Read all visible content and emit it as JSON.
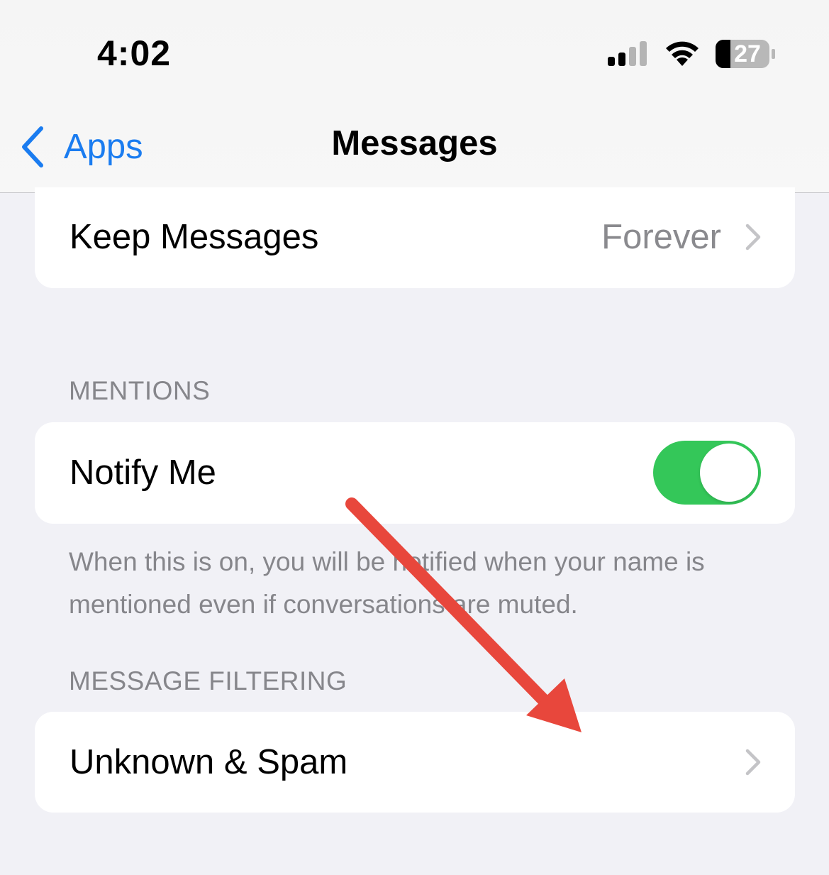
{
  "status_bar": {
    "time": "4:02",
    "battery_level": "27",
    "signal_bars_filled": 2,
    "signal_bars_total": 4
  },
  "nav": {
    "back_label": "Apps",
    "title": "Messages"
  },
  "keep_messages": {
    "label": "Keep Messages",
    "value": "Forever"
  },
  "mentions": {
    "header": "MENTIONS",
    "notify_label": "Notify Me",
    "notify_on": true,
    "footer": "When this is on, you will be notified when your name is mentioned even if conversations are muted."
  },
  "filtering": {
    "header": "MESSAGE FILTERING",
    "unknown_spam_label": "Unknown & Spam"
  },
  "colors": {
    "accent": "#1a7cf0",
    "toggle_on": "#34c759",
    "annotation_arrow": "#e8473c",
    "background": "#f1f1f6"
  }
}
